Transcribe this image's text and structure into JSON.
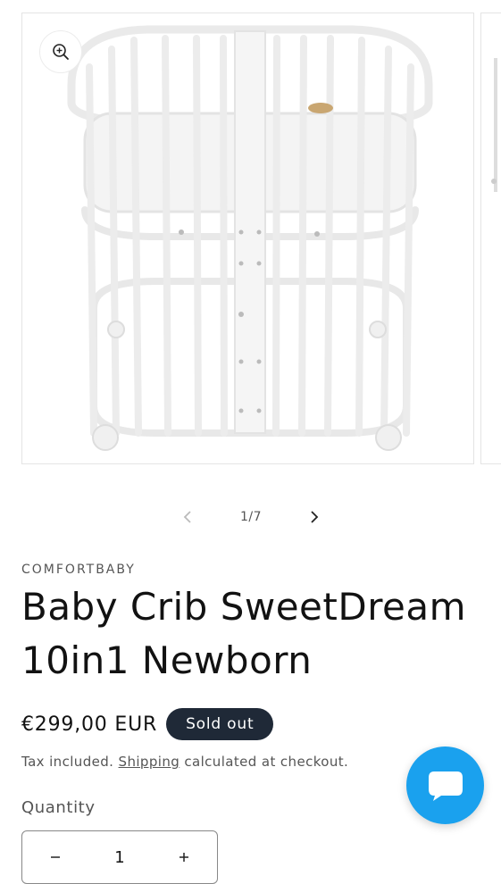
{
  "product": {
    "vendor": "COMFORTBABY",
    "title": "Baby Crib SweetDream 10in1 Newborn",
    "price": "€299,00 EUR",
    "badge": "Sold out",
    "tax_prefix": "Tax included.",
    "shipping_link": "Shipping",
    "tax_suffix": "calculated at checkout.",
    "quantity_label": "Quantity",
    "quantity_value": "1"
  },
  "gallery": {
    "counter": "1/7",
    "image_subject": "white oval baby crib on wheels"
  },
  "icons": {
    "zoom": "zoom-in-icon",
    "prev": "chevron-left-icon",
    "next": "chevron-right-icon",
    "chat": "chat-bubble-icon",
    "minus": "minus-icon",
    "plus": "plus-icon"
  },
  "colors": {
    "badge_bg": "#1f2937",
    "chat_bg": "#1aa1ee",
    "text": "#121212",
    "muted": "#555555"
  }
}
